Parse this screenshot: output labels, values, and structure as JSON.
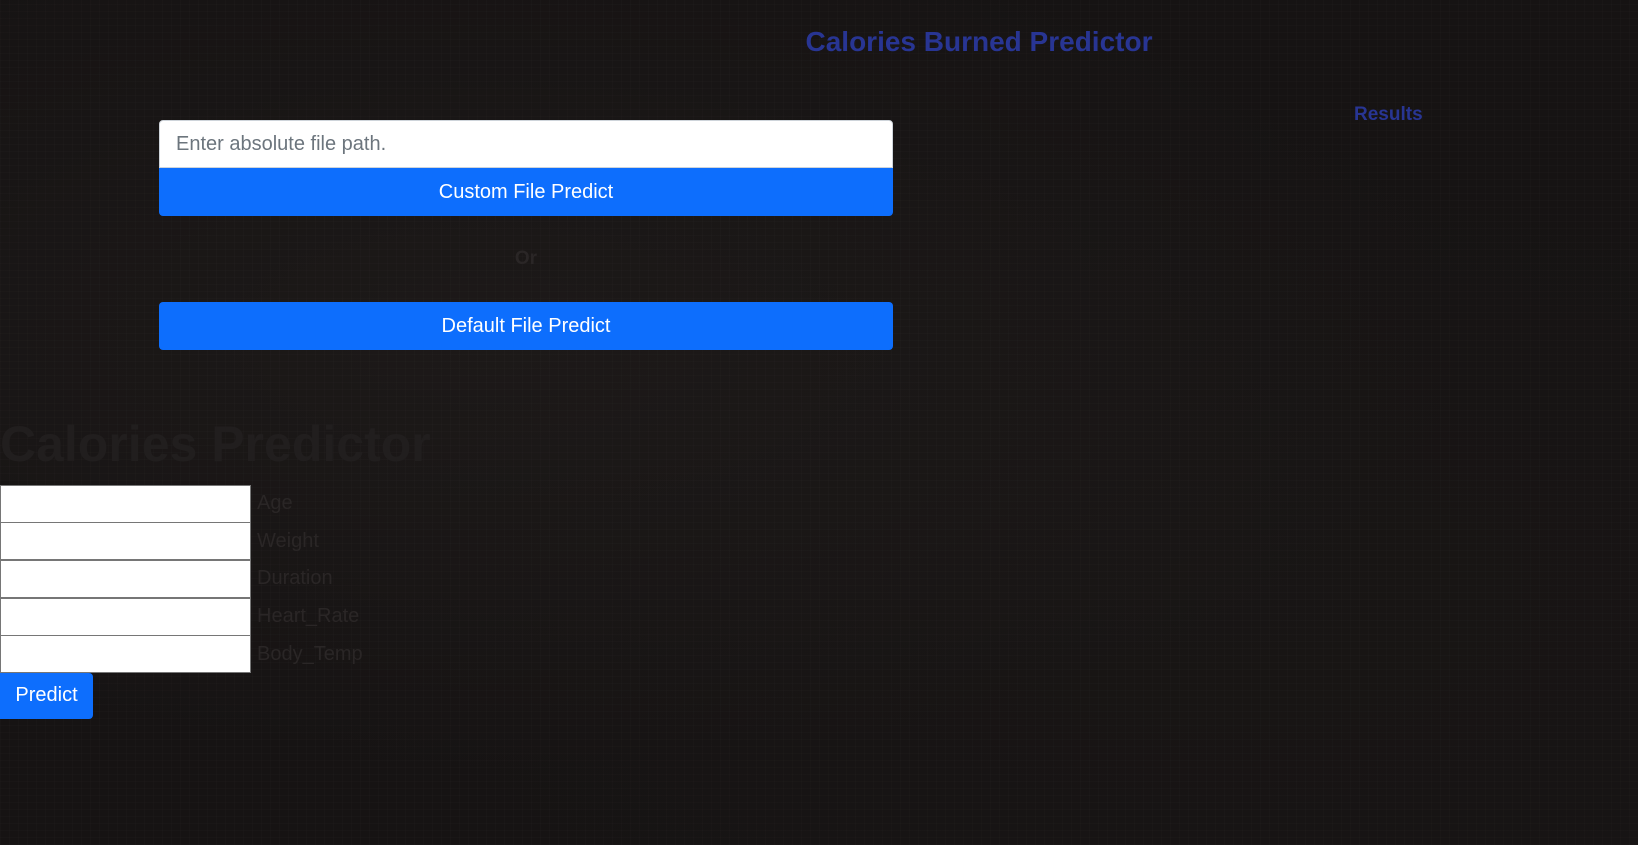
{
  "header": {
    "title": "Calories Burned Predictor",
    "results_label": "Results"
  },
  "file_panel": {
    "path_input": {
      "placeholder": "Enter absolute file path.",
      "value": ""
    },
    "custom_button_label": "Custom File Predict",
    "or_label": "Or",
    "default_button_label": "Default File Predict"
  },
  "manual_form": {
    "title": "Calories Predictor",
    "fields": [
      {
        "label": "Age",
        "value": ""
      },
      {
        "label": "Weight",
        "value": ""
      },
      {
        "label": "Duration",
        "value": ""
      },
      {
        "label": "Heart_Rate",
        "value": ""
      },
      {
        "label": "Body_Temp",
        "value": ""
      }
    ],
    "submit_label": "Predict"
  },
  "colors": {
    "background": "#161313",
    "heading_blue": "#283593",
    "button_blue": "#0d6efd",
    "muted_text": "#2a2626"
  }
}
